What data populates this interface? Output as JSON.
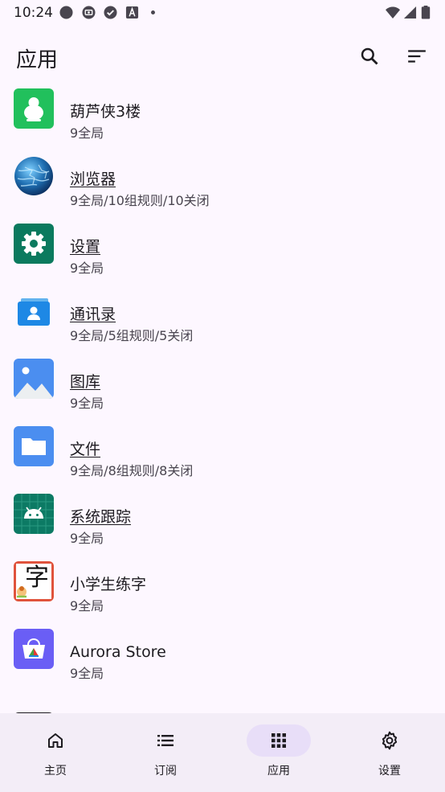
{
  "status": {
    "time": "10:24"
  },
  "header": {
    "title": "应用"
  },
  "apps": [
    {
      "name": "葫芦侠3楼",
      "sub": "9全局",
      "icon": "huluxia-gourd-icon"
    },
    {
      "name": "浏览器",
      "sub": "9全局/10组规则/10关闭",
      "icon": "browser-globe-icon"
    },
    {
      "name": "设置",
      "sub": "9全局",
      "icon": "settings-gear-icon"
    },
    {
      "name": "通讯录",
      "sub": "9全局/5组规则/5关闭",
      "icon": "contacts-icon"
    },
    {
      "name": "图库",
      "sub": "9全局",
      "icon": "gallery-icon"
    },
    {
      "name": "文件",
      "sub": "9全局/8组规则/8关闭",
      "icon": "files-folder-icon"
    },
    {
      "name": "系统跟踪",
      "sub": "9全局",
      "icon": "android-icon"
    },
    {
      "name": "小学生练字",
      "sub": "9全局",
      "icon": "zi-character-icon",
      "glyph": "字"
    },
    {
      "name": "Aurora Store",
      "sub": "9全局",
      "icon": "aurora-store-icon"
    }
  ],
  "nav": {
    "items": [
      {
        "label": "主页",
        "icon": "home-icon"
      },
      {
        "label": "订阅",
        "icon": "list-icon"
      },
      {
        "label": "应用",
        "icon": "apps-grid-icon",
        "active": true
      },
      {
        "label": "设置",
        "icon": "gear-icon"
      }
    ]
  }
}
